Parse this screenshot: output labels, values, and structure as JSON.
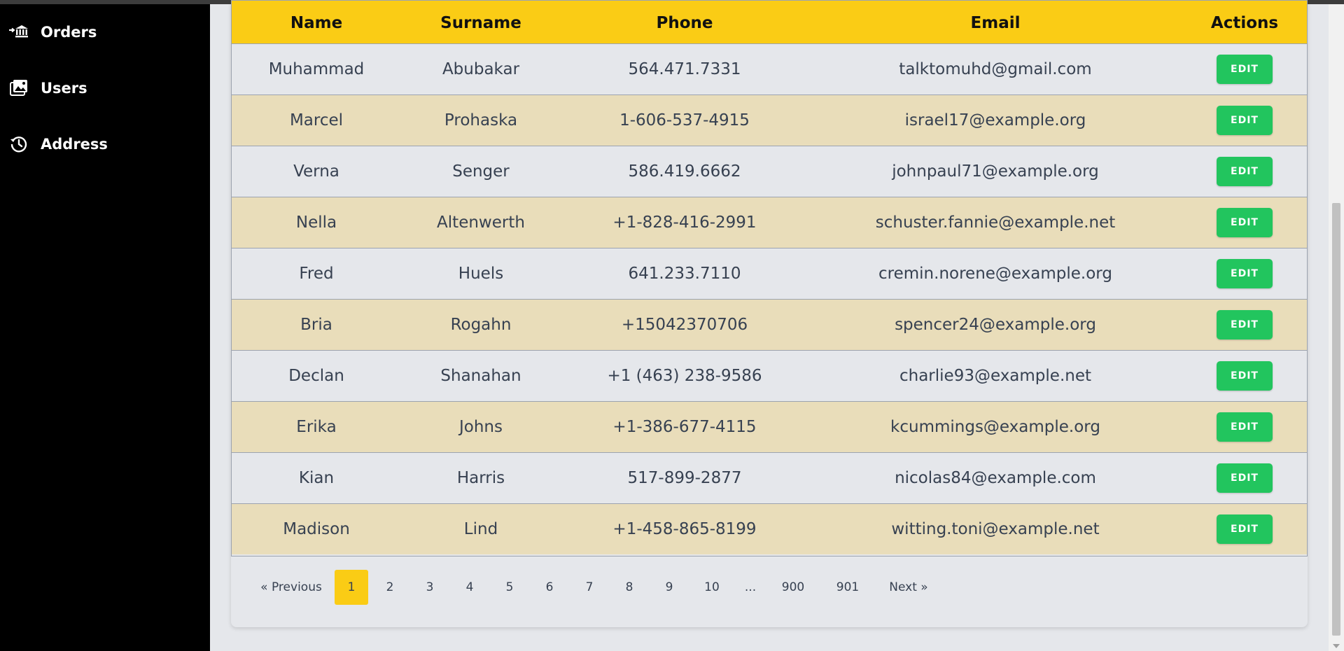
{
  "sidebar": {
    "items": [
      {
        "label": "Orders",
        "icon": "bank-icon"
      },
      {
        "label": "Users",
        "icon": "images-icon"
      },
      {
        "label": "Address",
        "icon": "history-icon"
      }
    ]
  },
  "table": {
    "headers": {
      "name": "Name",
      "surname": "Surname",
      "phone": "Phone",
      "email": "Email",
      "actions": "Actions"
    },
    "edit_label": "EDIT",
    "rows": [
      {
        "name": "Muhammad",
        "surname": "Abubakar",
        "phone": "564.471.7331",
        "email": "talktomuhd@gmail.com"
      },
      {
        "name": "Marcel",
        "surname": "Prohaska",
        "phone": "1-606-537-4915",
        "email": "israel17@example.org"
      },
      {
        "name": "Verna",
        "surname": "Senger",
        "phone": "586.419.6662",
        "email": "johnpaul71@example.org"
      },
      {
        "name": "Nella",
        "surname": "Altenwerth",
        "phone": "+1-828-416-2991",
        "email": "schuster.fannie@example.net"
      },
      {
        "name": "Fred",
        "surname": "Huels",
        "phone": "641.233.7110",
        "email": "cremin.norene@example.org"
      },
      {
        "name": "Bria",
        "surname": "Rogahn",
        "phone": "+15042370706",
        "email": "spencer24@example.org"
      },
      {
        "name": "Declan",
        "surname": "Shanahan",
        "phone": "+1 (463) 238-9586",
        "email": "charlie93@example.net"
      },
      {
        "name": "Erika",
        "surname": "Johns",
        "phone": "+1-386-677-4115",
        "email": "kcummings@example.org"
      },
      {
        "name": "Kian",
        "surname": "Harris",
        "phone": "517-899-2877",
        "email": "nicolas84@example.com"
      },
      {
        "name": "Madison",
        "surname": "Lind",
        "phone": "+1-458-865-8199",
        "email": "witting.toni@example.net"
      }
    ]
  },
  "pagination": {
    "previous": "« Previous",
    "next": "Next »",
    "pages": [
      "1",
      "2",
      "3",
      "4",
      "5",
      "6",
      "7",
      "8",
      "9",
      "10",
      "...",
      "900",
      "901"
    ],
    "active_page": "1"
  },
  "colors": {
    "header_bg": "#facc15",
    "row_odd": "#e5e7eb",
    "row_even": "#e9ddba",
    "edit_button": "#22c55e",
    "sidebar_bg": "#000000"
  }
}
